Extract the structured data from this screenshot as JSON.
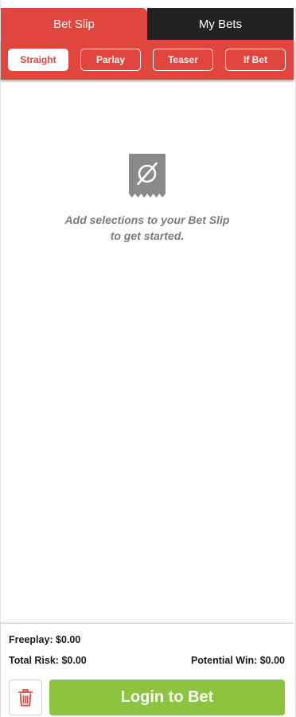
{
  "tabs": [
    {
      "label": "Bet Slip",
      "active": true
    },
    {
      "label": "My Bets",
      "active": false
    }
  ],
  "bet_types": [
    {
      "label": "Straight",
      "active": true
    },
    {
      "label": "Parlay",
      "active": false
    },
    {
      "label": "Teaser",
      "active": false
    },
    {
      "label": "If Bet",
      "active": false
    }
  ],
  "empty_state": {
    "icon": "empty-ticket-icon",
    "line1": "Add selections to your Bet Slip",
    "line2": "to get started."
  },
  "summary": {
    "freeplay": "Freeplay: $0.00",
    "total_risk": "Total Risk: $0.00",
    "potential_win": "Potential Win: $0.00"
  },
  "actions": {
    "trash_icon": "trash-icon",
    "login_label": "Login to Bet"
  },
  "colors": {
    "accent": "#e0463d",
    "dark_tab": "#222222",
    "login_green": "#8cc43f",
    "muted_text": "#7a7a7a"
  }
}
